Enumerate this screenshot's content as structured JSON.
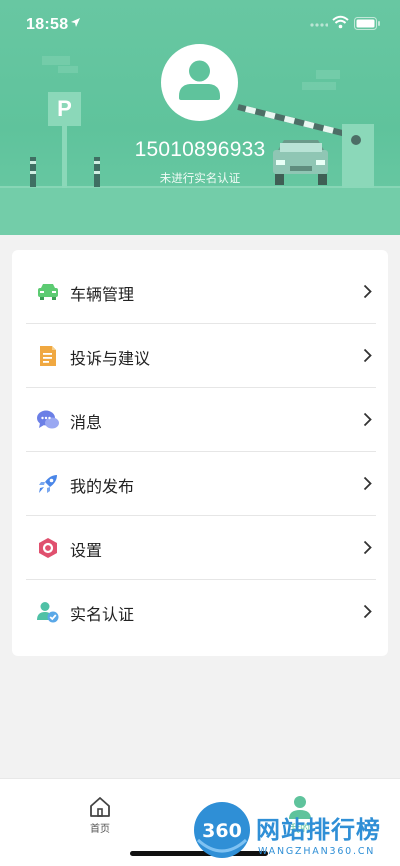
{
  "status_bar": {
    "time": "18:58"
  },
  "profile": {
    "phone": "15010896933",
    "verify_status": "未进行实名认证",
    "parking_sign": "P"
  },
  "menu": {
    "items": [
      {
        "label": "车辆管理",
        "icon": "car-icon",
        "color": "#5ccb72"
      },
      {
        "label": "投诉与建议",
        "icon": "document-edit-icon",
        "color": "#f0a841"
      },
      {
        "label": "消息",
        "icon": "chat-bubbles-icon",
        "color": "#6b7fe6"
      },
      {
        "label": "我的发布",
        "icon": "rocket-icon",
        "color": "#4a86e8"
      },
      {
        "label": "设置",
        "icon": "settings-hexagon-icon",
        "color": "#e0506e"
      },
      {
        "label": "实名认证",
        "icon": "user-verify-icon",
        "color": "#4fc1a6"
      }
    ]
  },
  "tabbar": {
    "home_label": "首页",
    "me_label": "我的",
    "active_color": "#5fc39c"
  },
  "watermark": {
    "logo_text": "360",
    "title": "网站排行榜",
    "subtitle": "WANGZHAN360.CN"
  },
  "colors": {
    "header_green": "#5fc39c",
    "background": "#f2f2f2"
  }
}
